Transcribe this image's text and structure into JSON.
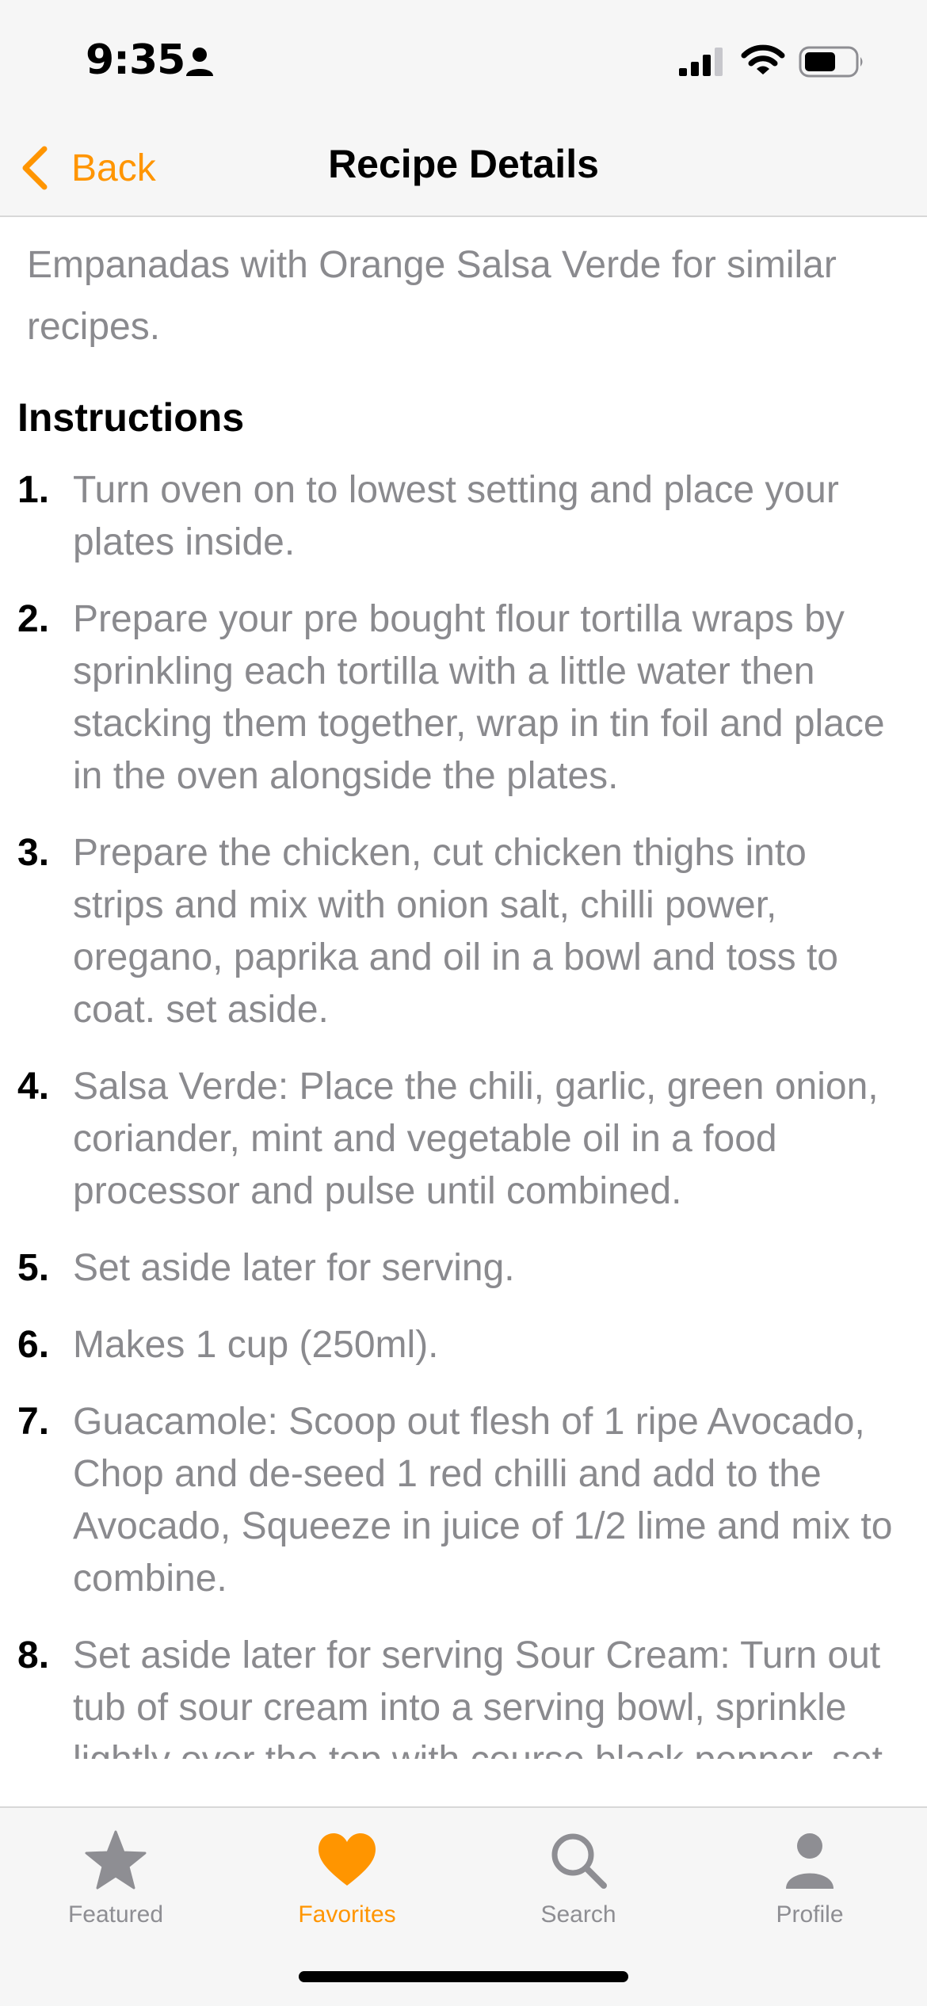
{
  "status_bar": {
    "time": "9:35",
    "icons": [
      "person-icon",
      "signal-icon",
      "wifi-icon",
      "battery-icon"
    ]
  },
  "nav": {
    "back_label": "Back",
    "title": "Recipe Details"
  },
  "intro_text": "Empanadas with Orange Salsa Verde for similar recipes.",
  "instructions": {
    "heading": "Instructions",
    "steps": [
      {
        "num": "1.",
        "text": "Turn oven on to lowest setting and place your plates inside."
      },
      {
        "num": "2.",
        "text": "Prepare your pre bought flour tortilla wraps by sprinkling each tortilla with a little water then stacking them together, wrap in tin foil and place in the oven alongside the plates."
      },
      {
        "num": "3.",
        "text": "Prepare the chicken, cut chicken thighs into strips and mix with onion salt, chilli power, oregano, paprika and oil in a bowl and toss to coat. set aside."
      },
      {
        "num": "4.",
        "text": "Salsa Verde: Place the chili, garlic, green onion, coriander, mint and vegetable oil in a food processor and pulse until combined."
      },
      {
        "num": "5.",
        "text": "Set aside later for serving."
      },
      {
        "num": "6.",
        "text": "Makes 1 cup (250ml)."
      },
      {
        "num": "7.",
        "text": "Guacamole: Scoop out flesh of 1 ripe Avocado, Chop and de-seed 1 red chilli and add to the Avocado, Squeeze in juice of 1/2 lime and mix to combine."
      },
      {
        "num": "8.",
        "text": "Set aside later for serving Sour Cream: Turn out tub of sour cream into a serving bowl, sprinkle lightly over the top with course black pepper, set aside."
      }
    ]
  },
  "tab_bar": {
    "tabs": [
      {
        "label": "Featured",
        "icon": "star-icon",
        "active": false
      },
      {
        "label": "Favorites",
        "icon": "heart-icon",
        "active": true
      },
      {
        "label": "Search",
        "icon": "search-icon",
        "active": false
      },
      {
        "label": "Profile",
        "icon": "person-icon",
        "active": false
      }
    ]
  },
  "colors": {
    "accent": "#ff9500",
    "body_text": "#8a8a8e",
    "tab_inactive": "#8e8e93",
    "bar_background": "#f6f6f6"
  }
}
